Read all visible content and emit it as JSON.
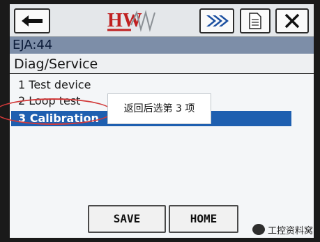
{
  "toolbar": {
    "back_icon": "arrow-left-icon",
    "forward_icon": "double-chevron-right-icon",
    "document_icon": "document-icon",
    "close_icon": "close-icon",
    "logo_text": "HW"
  },
  "header": {
    "device_tag": "EJA:44",
    "menu_title": "Diag/Service"
  },
  "menu": {
    "items": [
      {
        "label": "1 Test device"
      },
      {
        "label": "2 Loop test"
      },
      {
        "label": "3 Calibration"
      }
    ],
    "selected_index": 2,
    "selected_color": "#1e5fb0"
  },
  "annotation": {
    "callout_text": "返回后选第 3 项",
    "ring_color": "#d23a3a"
  },
  "softkeys": {
    "save": "SAVE",
    "home": "HOME"
  },
  "watermark": {
    "text": "工控资料窝"
  }
}
